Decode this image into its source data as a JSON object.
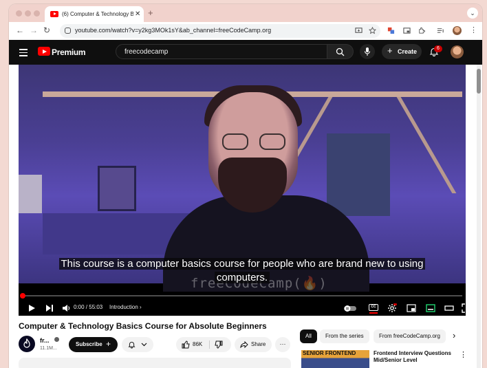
{
  "browser": {
    "tab_title": "(6) Computer & Technology B",
    "tab_close": "✕",
    "new_tab": "+",
    "tab_menu": "⌄",
    "url": "youtube.com/watch?v=y2kg3MOk1sY&ab_channel=freeCodeCamp.org",
    "nav": {
      "back": "←",
      "forward": "→",
      "reload": "↻"
    }
  },
  "youtube": {
    "brand": "Premium",
    "search_value": "freecodecamp",
    "create_label": "Create",
    "create_plus": "+",
    "notification_count": "6"
  },
  "player": {
    "caption_line1": "This course is a computer basics course for people who are brand new to using",
    "caption_line2": "computers.",
    "watermark": "freeCodeCamp(🔥)",
    "time": "0:00 / 55:03",
    "chapter": "Introduction ›",
    "cc_label": "CC",
    "progress_fraction": 0.0
  },
  "video": {
    "title": "Computer & Technology Basics Course for Absolute Beginners",
    "channel_name": "fr...",
    "subscribers": "11.1M...",
    "subscribe_label": "Subscribe",
    "subscribe_plus": "+",
    "like_count": "86K",
    "share_label": "Share",
    "more_label": "···"
  },
  "sidebar": {
    "chips": [
      "All",
      "From the series",
      "From freeCodeCamp.org"
    ],
    "next_chip": "›",
    "recommendation": {
      "thumb_text": "SENIOR FRONTEND",
      "title": "Frontend Interview Questions Mid/Senior Level",
      "menu": "⋮"
    }
  },
  "colors": {
    "youtube_red": "#ff0000",
    "youtube_dark": "#0f0f0f",
    "chip_bg": "#f2f2f2",
    "browser_frame": "#f1d2cc"
  },
  "icons": [
    "search-icon",
    "mic-icon",
    "bell-icon",
    "play-icon",
    "next-icon",
    "volume-icon",
    "settings-icon",
    "miniplayer-icon",
    "theater-icon",
    "fullscreen-icon",
    "like-icon",
    "dislike-icon",
    "share-icon",
    "bookmark-icon",
    "extensions-icon"
  ]
}
